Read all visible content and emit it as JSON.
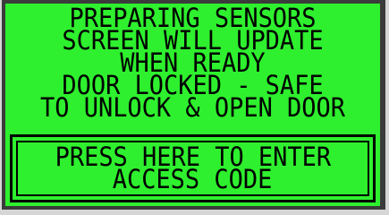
{
  "status": {
    "line1": "PREPARING SENSORS",
    "line2": "SCREEN WILL UPDATE",
    "line3": "WHEN READY",
    "line4": "DOOR LOCKED - SAFE",
    "line5": "TO UNLOCK & OPEN DOOR"
  },
  "access_button": {
    "line1": "PRESS HERE TO ENTER",
    "line2": "ACCESS CODE"
  },
  "colors": {
    "screen_background": "#2ef02e",
    "text": "#000000",
    "frame": "#3b3b3b",
    "bezel": "#d6d6d6"
  }
}
